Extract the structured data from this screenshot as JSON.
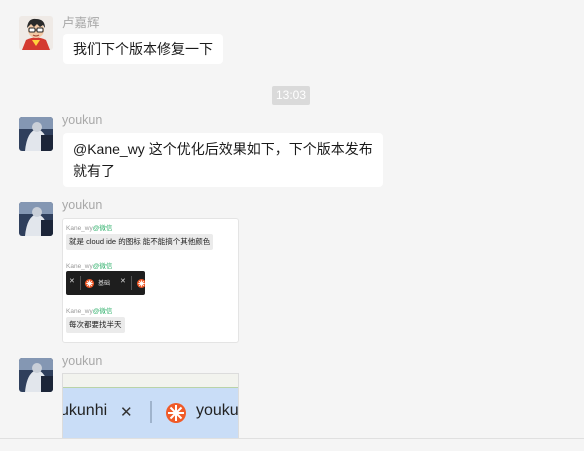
{
  "messages": [
    {
      "sender": "卢嘉辉",
      "text": "我们下个版本修复一下"
    },
    {
      "sender": "youkun",
      "line1": "@Kane_wy 这个优化后效果如下，下个版本发布",
      "line2": "就有了"
    },
    {
      "sender": "youkun"
    },
    {
      "sender": "youkun"
    }
  ],
  "timestamp": "13:03",
  "thumbnail": {
    "name1": "Kane_wy",
    "tag1": "@微信",
    "bubble1": "就是 cloud ide 的图标 能不能搞个其他颜色",
    "name2": "Kane_wy",
    "tag2": "@微信",
    "tab_close": "✕",
    "tab_label": "基础",
    "name3": "Kane_wy",
    "tag3": "@微信",
    "bubble3": "每次都要找半天"
  },
  "screenshot2": {
    "left_tab_text": "ukunhi",
    "close_glyph": "✕",
    "right_tab_text": "youku"
  },
  "colors": {
    "background": "#f5f5f5",
    "bubble": "#ffffff",
    "wechat_tag": "#2aae67",
    "tab_highlight": "#c9ddf7",
    "brand_orange": "#f05a28"
  }
}
